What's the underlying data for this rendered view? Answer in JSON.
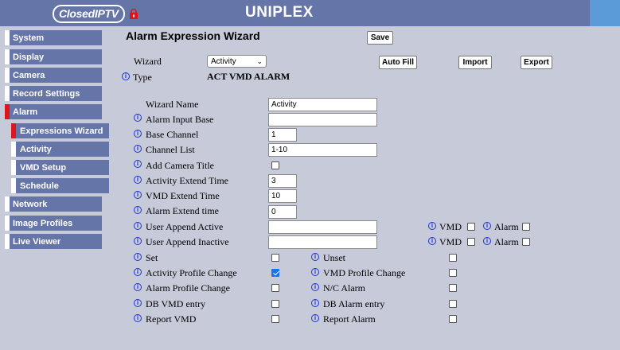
{
  "header": {
    "logo_text": "ClosedIPTV",
    "title": "UNIPLEX"
  },
  "sidebar": {
    "items": [
      {
        "label": "System"
      },
      {
        "label": "Display"
      },
      {
        "label": "Camera"
      },
      {
        "label": "Record Settings"
      },
      {
        "label": "Alarm",
        "active": true
      },
      {
        "label": "Expressions Wizard",
        "sub": true,
        "active": true
      },
      {
        "label": "Activity",
        "sub": true
      },
      {
        "label": "VMD Setup",
        "sub": true
      },
      {
        "label": "Schedule",
        "sub": true
      },
      {
        "label": "Network"
      },
      {
        "label": "Image Profiles"
      },
      {
        "label": "Live Viewer"
      }
    ]
  },
  "main": {
    "title": "Alarm Expression Wizard",
    "save_label": "Save",
    "wizard_label": "Wizard",
    "wizard_value": "Activity",
    "autofill_label": "Auto Fill",
    "import_label": "Import",
    "export_label": "Export",
    "type_label": "Type",
    "type_value": "ACT VMD ALARM",
    "fields": {
      "wizard_name": {
        "label": "Wizard Name",
        "value": "Activity"
      },
      "alarm_input_base": {
        "label": "Alarm Input Base",
        "value": ""
      },
      "base_channel": {
        "label": "Base Channel",
        "value": "1"
      },
      "channel_list": {
        "label": "Channel List",
        "value": "1-10"
      },
      "add_camera_title": {
        "label": "Add Camera Title",
        "checked": false
      },
      "activity_extend_time": {
        "label": "Activity Extend Time",
        "value": "3"
      },
      "vmd_extend_time": {
        "label": "VMD Extend Time",
        "value": "10"
      },
      "alarm_extend_time": {
        "label": "Alarm Extend time",
        "value": "0"
      },
      "user_append_active": {
        "label": "User Append Active",
        "value": ""
      },
      "user_append_inactive": {
        "label": "User Append Inactive",
        "value": ""
      }
    },
    "vmd_label": "VMD",
    "alarm_label": "Alarm",
    "options": {
      "set": "Set",
      "unset": "Unset",
      "activity_profile_change": "Activity Profile Change",
      "vmd_profile_change": "VMD Profile Change",
      "alarm_profile_change": "Alarm Profile Change",
      "nc_alarm": "N/C Alarm",
      "db_vmd_entry": "DB VMD entry",
      "db_alarm_entry": "DB Alarm entry",
      "report_vmd": "Report VMD",
      "report_alarm": "Report Alarm"
    },
    "checked": {
      "activity_profile_change": true
    }
  },
  "colors": {
    "nav_bg": "#6675a8",
    "page_bg": "#c6cad9",
    "active_marker": "#e0141c",
    "info_icon": "#2033d0"
  }
}
